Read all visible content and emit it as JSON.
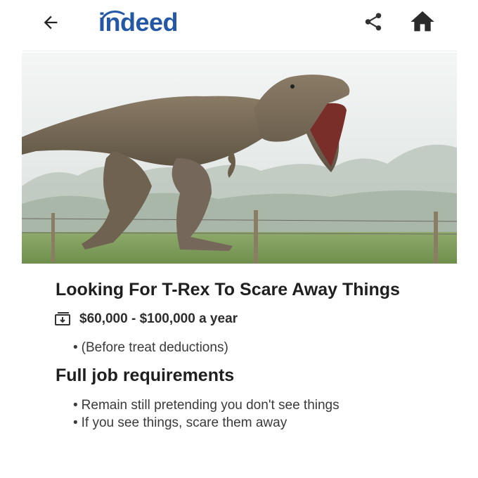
{
  "header": {
    "logo_text": "indeed",
    "logo_color": "#2557a7",
    "icons": [
      "back-arrow-icon",
      "share-icon",
      "home-icon"
    ]
  },
  "job": {
    "title": "Looking For T-Rex To Scare Away Things",
    "salary": "$60,000 - $100,000 a year",
    "salary_icon": "money-icon",
    "salary_note": "(Before treat deductions)"
  },
  "requirements": {
    "title": "Full job requirements",
    "items": [
      "Remain still pretending you don't see things",
      "If you see things, scare them away"
    ]
  }
}
